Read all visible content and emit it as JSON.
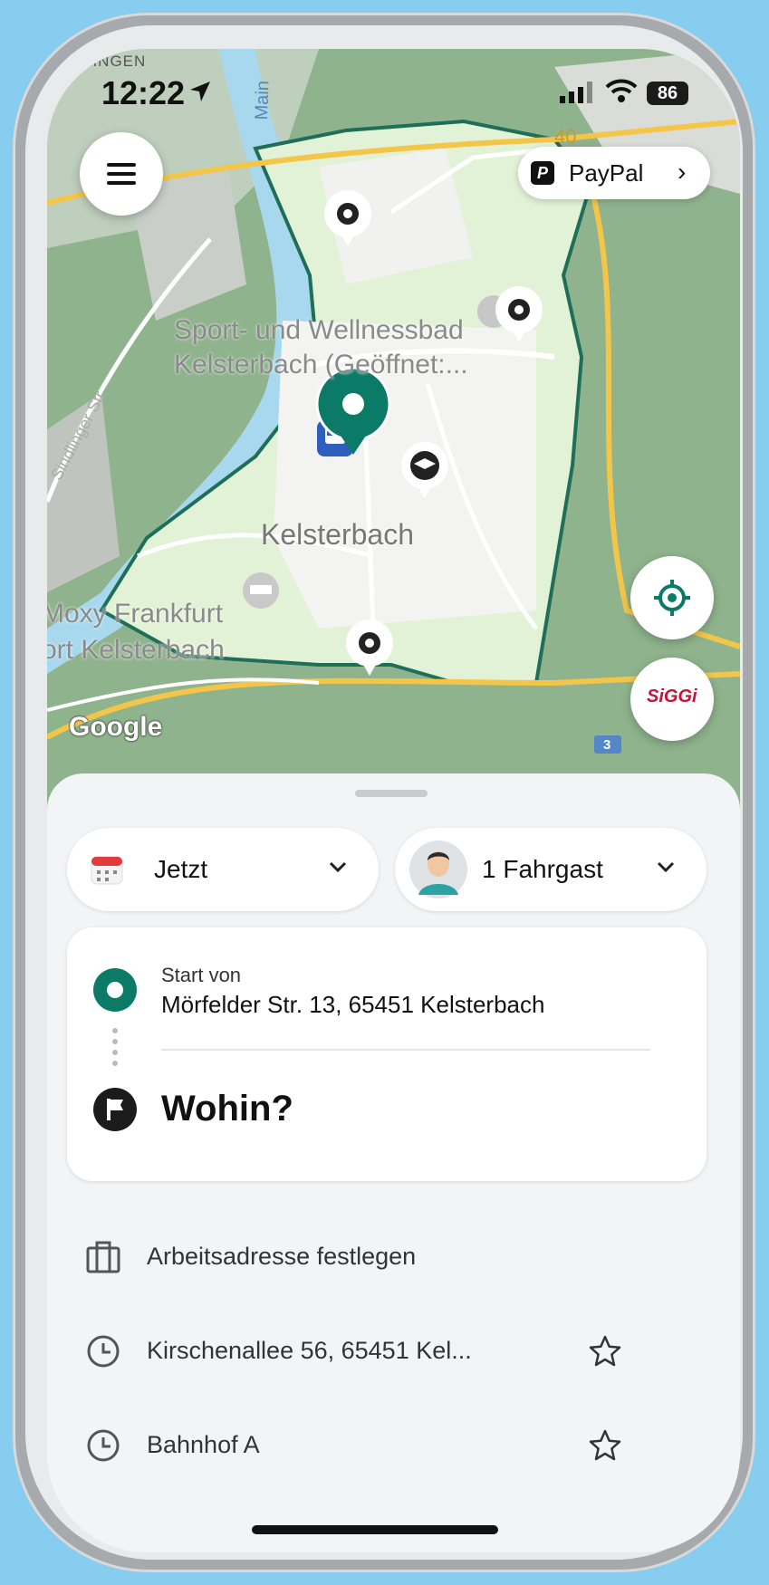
{
  "status_bar": {
    "location_label": "LINGEN",
    "time": "12:22",
    "battery": "86"
  },
  "map": {
    "labels": {
      "poi_1_line1": "Sport- und Wellnessbad",
      "poi_1_line2": "Kelsterbach (Geöffnet:...",
      "town": "Kelsterbach",
      "hotel_line1": "Moxy Frankfurt",
      "hotel_line2": "ort Kelsterbach",
      "river": "Main",
      "street": "Sindlinger Str.",
      "road_number_1": "40",
      "road_number_2": "3",
      "attribution": "Google"
    },
    "colors": {
      "zone_fill": "#e3f3d8",
      "zone_border": "#1e6e58",
      "accent": "#0b7a66"
    }
  },
  "toolbar": {
    "paypal_label": "PayPal",
    "siggi_label": "SiGGi"
  },
  "booking": {
    "when_label": "Jetzt",
    "passengers_label": "1 Fahrgast",
    "start_label": "Start von",
    "start_address": "Mörfelder Str. 13, 65451 Kelsterbach",
    "destination_placeholder": "Wohin?"
  },
  "suggestions": [
    {
      "icon": "briefcase-icon",
      "label": "Arbeitsadresse festlegen",
      "favorite": false
    },
    {
      "icon": "clock-icon",
      "label": "Kirschenallee 56, 65451 Kel...",
      "favorite": true
    },
    {
      "icon": "clock-icon",
      "label": "Bahnhof A",
      "favorite": true
    }
  ]
}
